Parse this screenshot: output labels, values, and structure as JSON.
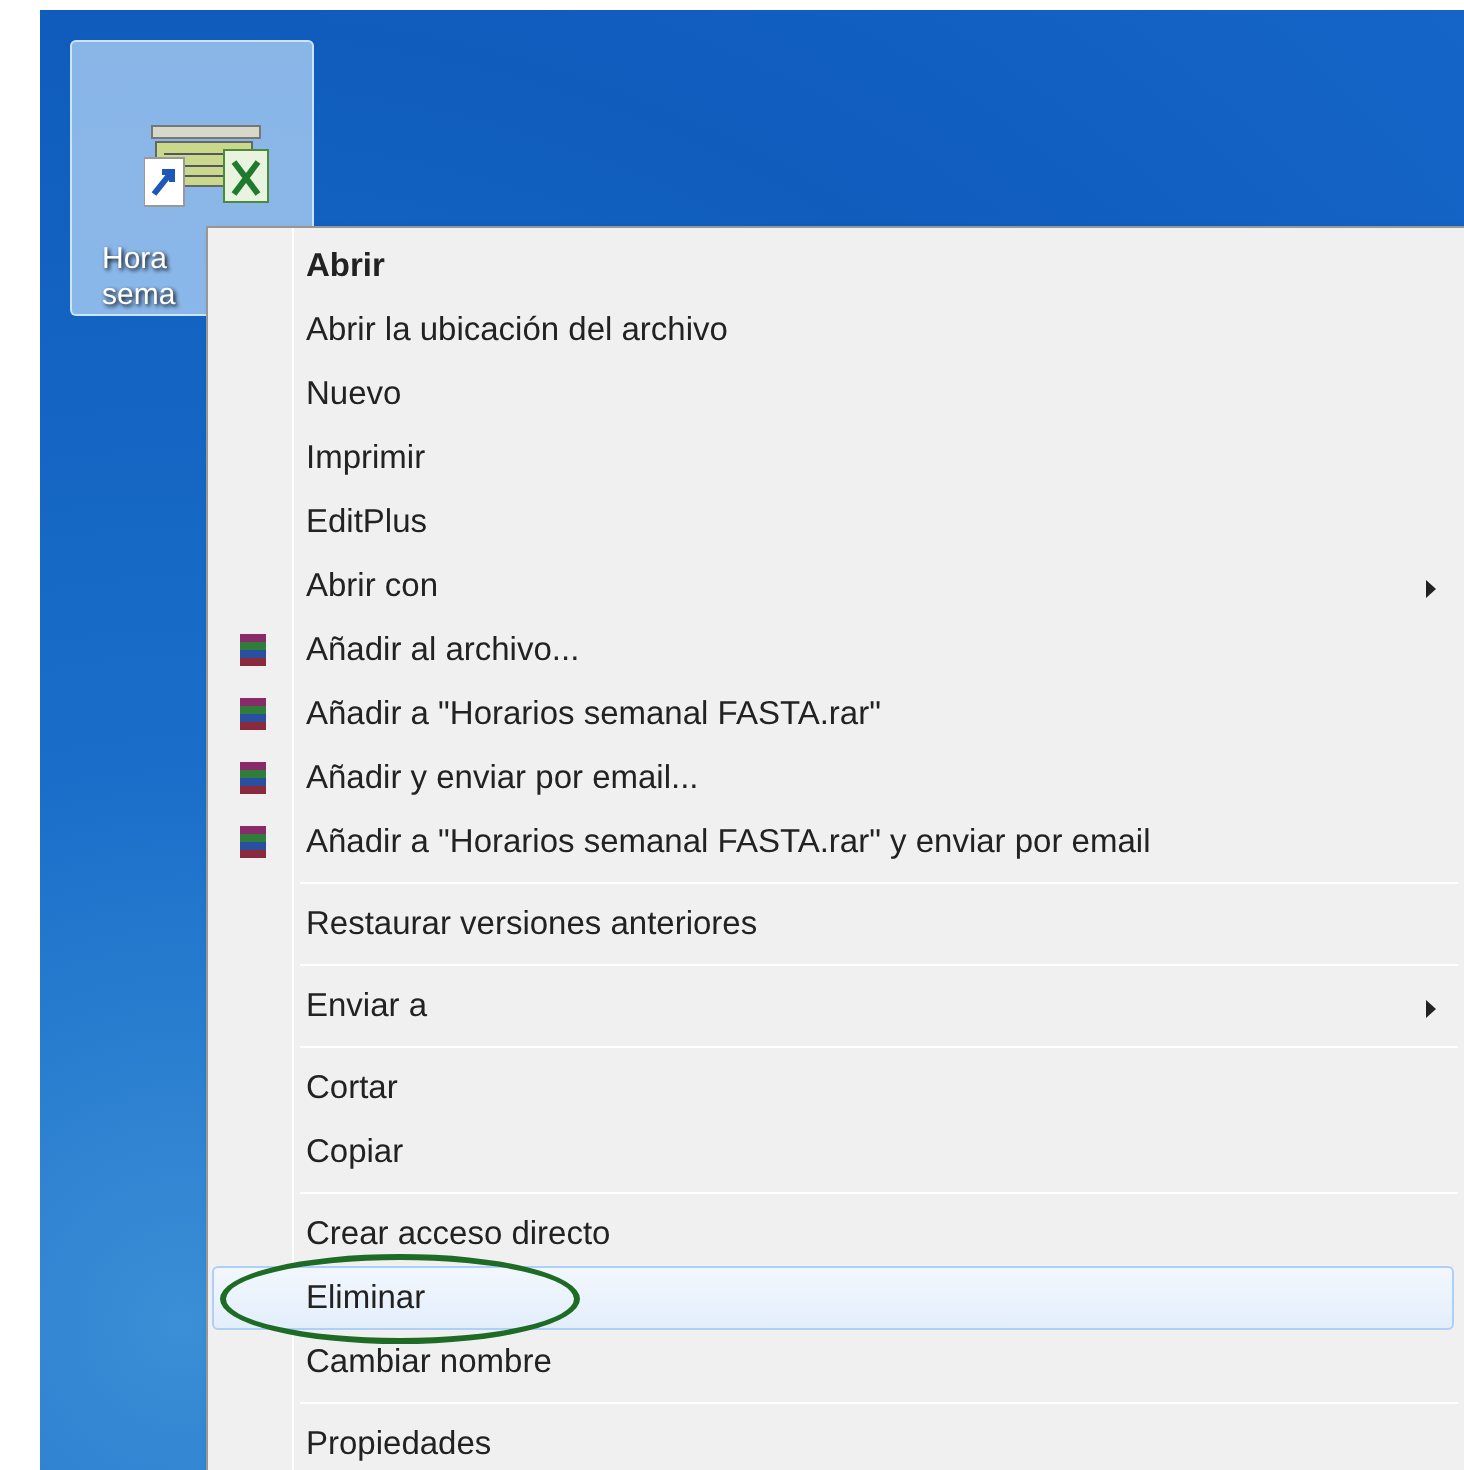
{
  "desktop_icon": {
    "label_lines": [
      "Hora",
      "sema"
    ],
    "selected": true
  },
  "context_menu": {
    "groups": [
      {
        "items": [
          {
            "label": "Abrir",
            "kind": "plain",
            "default": true,
            "submenu": false,
            "selected": false
          },
          {
            "label": "Abrir la ubicación del archivo",
            "kind": "plain",
            "default": false,
            "submenu": false,
            "selected": false
          },
          {
            "label": "Nuevo",
            "kind": "plain",
            "default": false,
            "submenu": false,
            "selected": false
          },
          {
            "label": "Imprimir",
            "kind": "plain",
            "default": false,
            "submenu": false,
            "selected": false
          },
          {
            "label": "EditPlus",
            "kind": "plain",
            "default": false,
            "submenu": false,
            "selected": false
          },
          {
            "label": "Abrir con",
            "kind": "plain",
            "default": false,
            "submenu": true,
            "selected": false
          },
          {
            "label": "Añadir al archivo...",
            "kind": "archive",
            "default": false,
            "submenu": false,
            "selected": false
          },
          {
            "label": "Añadir a \"Horarios semanal FASTA.rar\"",
            "kind": "archive",
            "default": false,
            "submenu": false,
            "selected": false
          },
          {
            "label": "Añadir y enviar por email...",
            "kind": "archive",
            "default": false,
            "submenu": false,
            "selected": false
          },
          {
            "label": "Añadir a \"Horarios semanal FASTA.rar\" y enviar por email",
            "kind": "archive",
            "default": false,
            "submenu": false,
            "selected": false
          }
        ]
      },
      {
        "items": [
          {
            "label": "Restaurar versiones anteriores",
            "kind": "plain",
            "default": false,
            "submenu": false,
            "selected": false
          }
        ]
      },
      {
        "items": [
          {
            "label": "Enviar a",
            "kind": "plain",
            "default": false,
            "submenu": true,
            "selected": false
          }
        ]
      },
      {
        "items": [
          {
            "label": "Cortar",
            "kind": "plain",
            "default": false,
            "submenu": false,
            "selected": false
          },
          {
            "label": "Copiar",
            "kind": "plain",
            "default": false,
            "submenu": false,
            "selected": false
          }
        ]
      },
      {
        "items": [
          {
            "label": "Crear acceso directo",
            "kind": "plain",
            "default": false,
            "submenu": false,
            "selected": false
          },
          {
            "label": "Eliminar",
            "kind": "plain",
            "default": false,
            "submenu": false,
            "selected": true,
            "circled": true
          },
          {
            "label": "Cambiar nombre",
            "kind": "plain",
            "default": false,
            "submenu": false,
            "selected": false
          }
        ]
      },
      {
        "items": [
          {
            "label": "Propiedades",
            "kind": "plain",
            "default": false,
            "submenu": false,
            "selected": false
          }
        ]
      }
    ]
  }
}
